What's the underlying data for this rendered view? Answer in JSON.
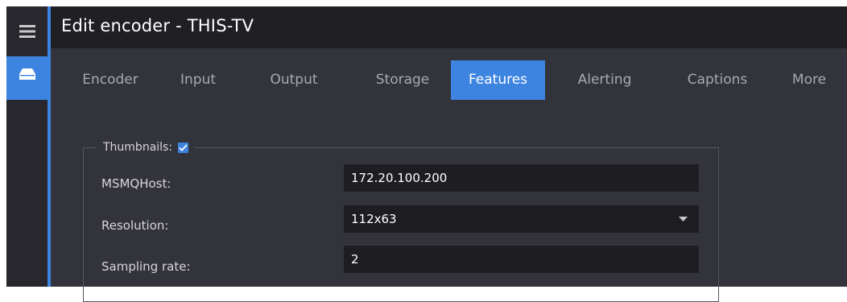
{
  "window": {
    "title": "Edit encoder - THIS-TV"
  },
  "rail": {
    "menu_icon": "hamburger-menu-icon",
    "active_icon": "drive-icon",
    "accent_color": "#3d83e0"
  },
  "tabs": [
    {
      "label": "Encoder",
      "active": false
    },
    {
      "label": "Input",
      "active": false
    },
    {
      "label": "Output",
      "active": false
    },
    {
      "label": "Storage",
      "active": false
    },
    {
      "label": "Features",
      "active": true
    },
    {
      "label": "Alerting",
      "active": false
    },
    {
      "label": "Captions",
      "active": false
    },
    {
      "label": "More",
      "active": false
    }
  ],
  "thumbnails": {
    "legend": "Thumbnails:",
    "enabled": true,
    "fields": {
      "msmq_host": {
        "label": "MSMQHost:",
        "value": "172.20.100.200"
      },
      "resolution": {
        "label": "Resolution:",
        "value": "112x63"
      },
      "sampling_rate": {
        "label": "Sampling rate:",
        "value": "2"
      }
    }
  }
}
